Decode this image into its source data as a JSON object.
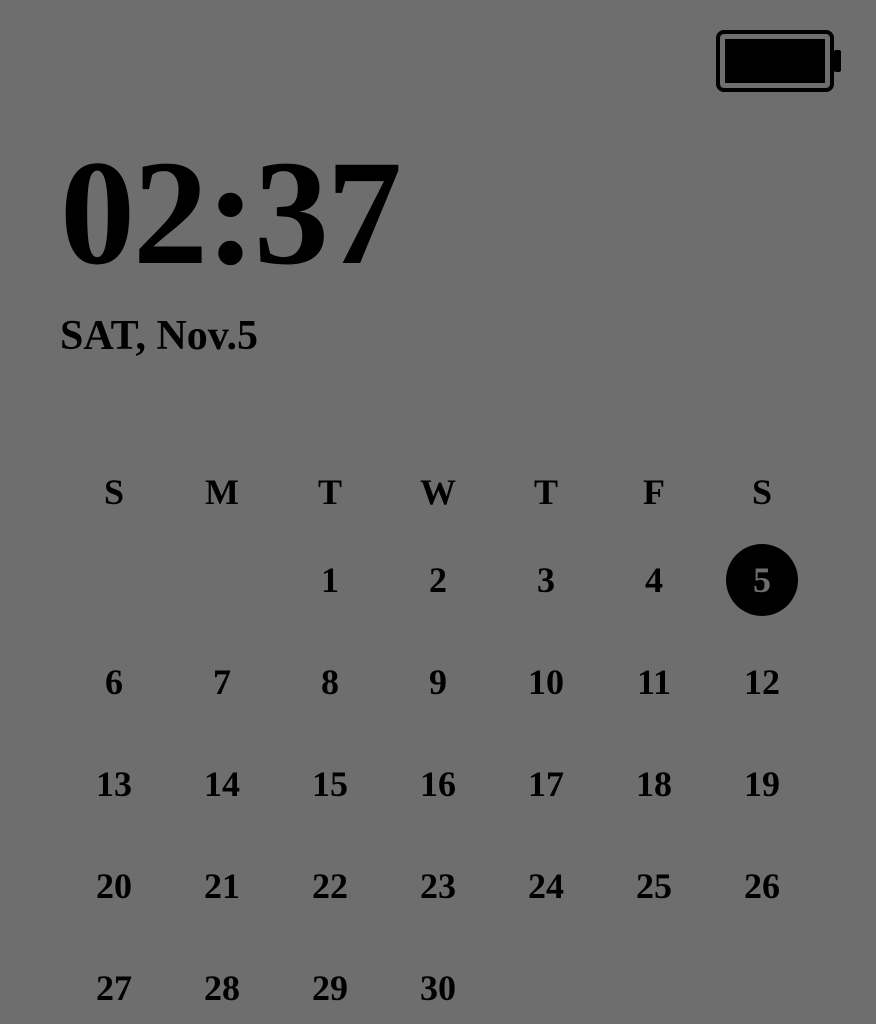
{
  "status": {
    "battery_level": 100
  },
  "clock": {
    "time": "02:37",
    "date": "SAT, Nov.5"
  },
  "calendar": {
    "day_headers": [
      "S",
      "M",
      "T",
      "W",
      "T",
      "F",
      "S"
    ],
    "today": 5,
    "weeks": [
      [
        "",
        "",
        "1",
        "2",
        "3",
        "4",
        "5"
      ],
      [
        "6",
        "7",
        "8",
        "9",
        "10",
        "11",
        "12"
      ],
      [
        "13",
        "14",
        "15",
        "16",
        "17",
        "18",
        "19"
      ],
      [
        "20",
        "21",
        "22",
        "23",
        "24",
        "25",
        "26"
      ],
      [
        "27",
        "28",
        "29",
        "30",
        "",
        "",
        ""
      ]
    ]
  }
}
